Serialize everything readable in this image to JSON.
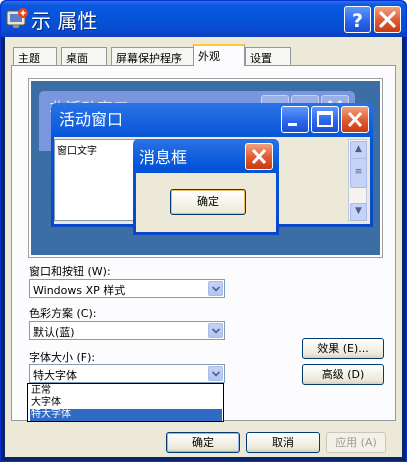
{
  "window": {
    "title": "示 属性"
  },
  "titlebar_buttons": {
    "help": "help-icon",
    "close": "close-icon"
  },
  "tabs": [
    {
      "label": "主题"
    },
    {
      "label": "桌面"
    },
    {
      "label": "屏幕保护程序"
    },
    {
      "label": "外观",
      "active": true
    },
    {
      "label": "设置"
    }
  ],
  "preview": {
    "inactive_title": "非活动窗口",
    "active_title": "活动窗口",
    "window_text": "窗口文字",
    "msgbox_title": "消息框",
    "msgbox_ok": "确定"
  },
  "form": {
    "window_buttons_label": "窗口和按钮 (W):",
    "window_buttons_value": "Windows XP 样式",
    "color_scheme_label": "色彩方案 (C):",
    "color_scheme_value": "默认(蓝)",
    "font_size_label": "字体大小 (F):",
    "font_size_value": "特大字体",
    "font_size_options": [
      "正常",
      "大字体",
      "特大字体"
    ],
    "effects_button": "效果 (E)...",
    "advanced_button": "高级 (D)"
  },
  "footer": {
    "ok": "确定",
    "cancel": "取消",
    "apply": "应用 (A)"
  },
  "colors": {
    "titlebar": "#0454d8",
    "desktop_preview": "#3a6ea5",
    "selection": "#316ac5",
    "dialog_face": "#ece9d8"
  }
}
